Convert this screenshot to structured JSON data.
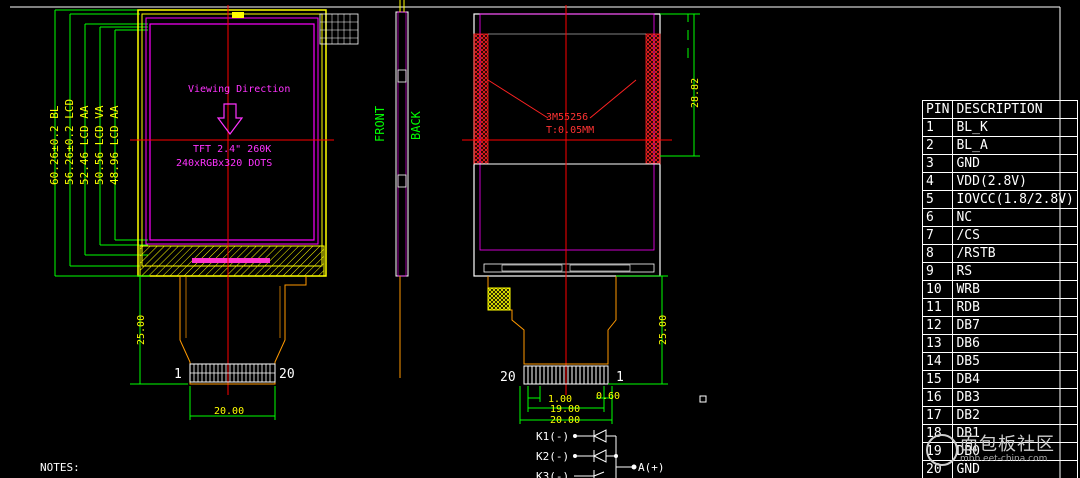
{
  "drawing": {
    "front_label": "FRONT",
    "back_label": "BACK",
    "notes_label": "NOTES:"
  },
  "front_view": {
    "viewing_direction": "Viewing Direction",
    "tft_spec": "TFT 2.4\" 260K",
    "dots_spec": "240xRGBx320 DOTS",
    "dims": [
      "60.26±0.2 BL",
      "56.26±0.2 LCD",
      "52.46 LCD AA",
      "50.56 LCD VA",
      "48.96 LCD AA"
    ],
    "fpc_width": "20.00",
    "fpc_length": "25.00",
    "pin_first": "1",
    "pin_last": "20"
  },
  "back_view": {
    "tape_label": "3M55256",
    "tape_thickness": "T:0.05MM",
    "dim_height": "28.82",
    "fpc_length": "25.00",
    "pin_first": "20",
    "pin_last": "1",
    "dim_pitch": "1.00",
    "dim_end": "0.60",
    "dim_span": "19.00",
    "dim_total": "20.00"
  },
  "circuit": {
    "k1": "K1(-)",
    "k2": "K2(-)",
    "k3": "K3(-)",
    "anode": "A(+)"
  },
  "pin_table": {
    "header_pin": "PIN",
    "header_desc": "DESCRIPTION",
    "rows": [
      {
        "pin": "1",
        "desc": "BL_K"
      },
      {
        "pin": "2",
        "desc": "BL_A"
      },
      {
        "pin": "3",
        "desc": "GND"
      },
      {
        "pin": "4",
        "desc": "VDD(2.8V)"
      },
      {
        "pin": "5",
        "desc": "IOVCC(1.8/2.8V)"
      },
      {
        "pin": "6",
        "desc": "NC"
      },
      {
        "pin": "7",
        "desc": "/CS"
      },
      {
        "pin": "8",
        "desc": "/RSTB"
      },
      {
        "pin": "9",
        "desc": "RS"
      },
      {
        "pin": "10",
        "desc": "WRB"
      },
      {
        "pin": "11",
        "desc": "RDB"
      },
      {
        "pin": "12",
        "desc": "DB7"
      },
      {
        "pin": "13",
        "desc": "DB6"
      },
      {
        "pin": "14",
        "desc": "DB5"
      },
      {
        "pin": "15",
        "desc": "DB4"
      },
      {
        "pin": "16",
        "desc": "DB3"
      },
      {
        "pin": "17",
        "desc": "DB2"
      },
      {
        "pin": "18",
        "desc": "DB1"
      },
      {
        "pin": "19",
        "desc": "DB0"
      },
      {
        "pin": "20",
        "desc": "GND"
      }
    ]
  },
  "watermark": {
    "title": "面包板社区",
    "url": "mbb.eet-china.com"
  },
  "colors": {
    "background": "#000000",
    "outline": "#ffff00",
    "dimension": "#00ff00",
    "centerline": "#ff0000",
    "panel": "#ff00ff",
    "fpc": "#ff9900"
  }
}
